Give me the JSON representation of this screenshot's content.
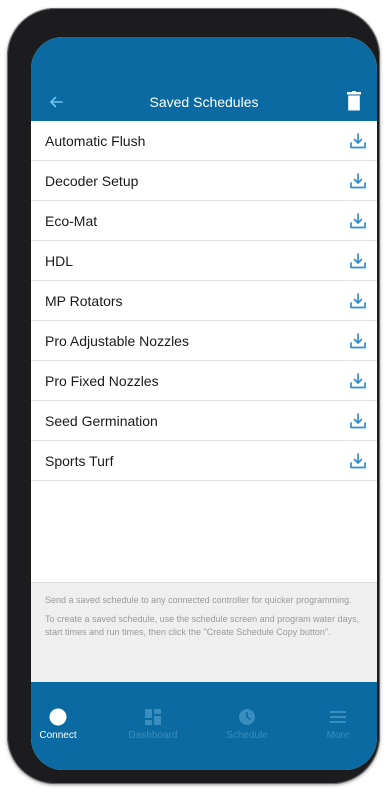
{
  "header": {
    "title": "Saved Schedules",
    "back_icon": "arrow-left-icon",
    "trash_icon": "trash-icon"
  },
  "schedules": [
    {
      "label": "Automatic Flush"
    },
    {
      "label": "Decoder Setup"
    },
    {
      "label": "Eco-Mat"
    },
    {
      "label": "HDL"
    },
    {
      "label": "MP Rotators"
    },
    {
      "label": "Pro Adjustable Nozzles"
    },
    {
      "label": "Pro Fixed Nozzles"
    },
    {
      "label": "Seed Germination"
    },
    {
      "label": "Sports Turf"
    }
  ],
  "info": {
    "line1": "Send a saved schedule to any connected controller for quicker programming.",
    "line2": "To create a saved schedule, use the schedule screen and program water days, start times and run times, then click the \"Create Schedule Copy button\"."
  },
  "tabs": [
    {
      "label": "Connect",
      "icon": "circle-icon",
      "active": true
    },
    {
      "label": "Dashboard",
      "icon": "dashboard-grid-icon",
      "active": false
    },
    {
      "label": "Schedule",
      "icon": "clock-icon",
      "active": false
    },
    {
      "label": "More",
      "icon": "menu-icon",
      "active": false
    }
  ],
  "colors": {
    "header": "#0a6aa1",
    "accent": "#2a8fd6",
    "tab_inactive": "#3a8dbf",
    "info_bg": "#efeff0"
  }
}
